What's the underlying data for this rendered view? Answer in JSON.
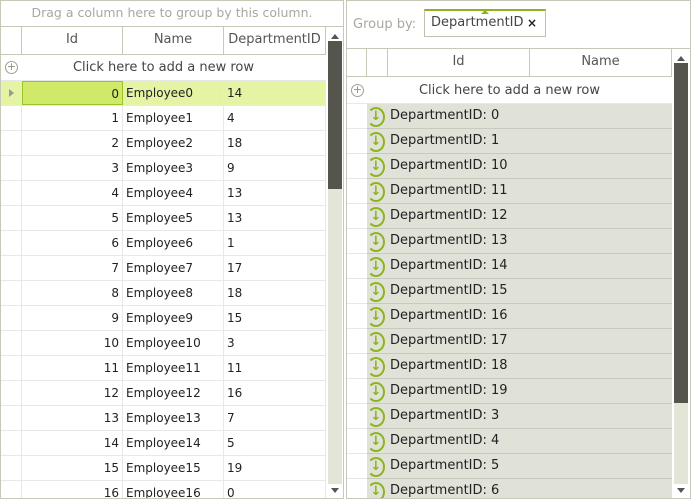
{
  "left_grid": {
    "group_hint": "Drag a column here to group by this column.",
    "columns": [
      "Id",
      "Name",
      "DepartmentID"
    ],
    "add_row": "Click here to add a new row",
    "rows": [
      {
        "id": "0",
        "name": "Employee0",
        "dept": "14"
      },
      {
        "id": "1",
        "name": "Employee1",
        "dept": "4"
      },
      {
        "id": "2",
        "name": "Employee2",
        "dept": "18"
      },
      {
        "id": "3",
        "name": "Employee3",
        "dept": "9"
      },
      {
        "id": "4",
        "name": "Employee4",
        "dept": "13"
      },
      {
        "id": "5",
        "name": "Employee5",
        "dept": "13"
      },
      {
        "id": "6",
        "name": "Employee6",
        "dept": "1"
      },
      {
        "id": "7",
        "name": "Employee7",
        "dept": "17"
      },
      {
        "id": "8",
        "name": "Employee8",
        "dept": "18"
      },
      {
        "id": "9",
        "name": "Employee9",
        "dept": "15"
      },
      {
        "id": "10",
        "name": "Employee10",
        "dept": "3"
      },
      {
        "id": "11",
        "name": "Employee11",
        "dept": "11"
      },
      {
        "id": "12",
        "name": "Employee12",
        "dept": "16"
      },
      {
        "id": "13",
        "name": "Employee13",
        "dept": "7"
      },
      {
        "id": "14",
        "name": "Employee14",
        "dept": "5"
      },
      {
        "id": "15",
        "name": "Employee15",
        "dept": "19"
      },
      {
        "id": "16",
        "name": "Employee16",
        "dept": "0"
      }
    ]
  },
  "right_grid": {
    "group_by_label": "Group by:",
    "group_chip": "DepartmentID",
    "chip_close": "×",
    "columns": [
      "Id",
      "Name"
    ],
    "add_row": "Click here to add a new row",
    "groups": [
      "DepartmentID: 0",
      "DepartmentID: 1",
      "DepartmentID: 10",
      "DepartmentID: 11",
      "DepartmentID: 12",
      "DepartmentID: 13",
      "DepartmentID: 14",
      "DepartmentID: 15",
      "DepartmentID: 16",
      "DepartmentID: 17",
      "DepartmentID: 18",
      "DepartmentID: 19",
      "DepartmentID: 3",
      "DepartmentID: 4",
      "DepartmentID: 5",
      "DepartmentID: 6"
    ]
  },
  "colors": {
    "accent": "#8cb41e",
    "selected_row": "#e4f3a4",
    "group_row": "#e0e2d8"
  }
}
